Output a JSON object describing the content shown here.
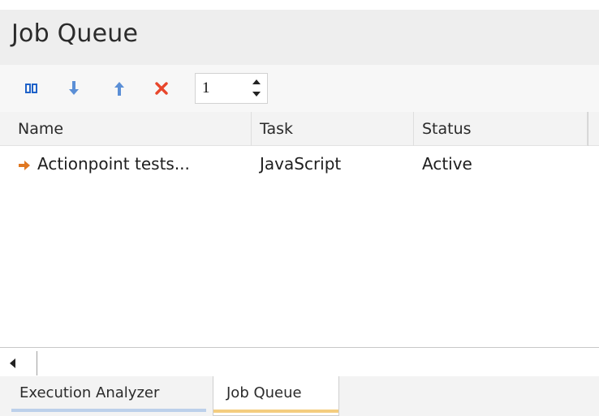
{
  "window": {
    "title": "Job Queue"
  },
  "toolbar": {
    "pause_icon": "pause-icon",
    "down_icon": "arrow-down-icon",
    "up_icon": "arrow-up-icon",
    "delete_icon": "delete-x-icon",
    "spinner_value": "1"
  },
  "table": {
    "columns": [
      "Name",
      "Task",
      "Status",
      ""
    ],
    "rows": [
      {
        "icon": "arrow-right-icon",
        "name": "Actionpoint tests...",
        "task": "JavaScript",
        "status": "Active"
      }
    ]
  },
  "tabs": [
    {
      "label": "Execution Analyzer",
      "active": false
    },
    {
      "label": "Job Queue",
      "active": true
    }
  ],
  "colors": {
    "pause": "#1f62c9",
    "arrow": "#5b8fd6",
    "delete": "#e8462b",
    "row_arrow": "#e07822",
    "active_tab_accent": "#f4cd7f",
    "inactive_tab_accent": "#bcd0ea"
  }
}
